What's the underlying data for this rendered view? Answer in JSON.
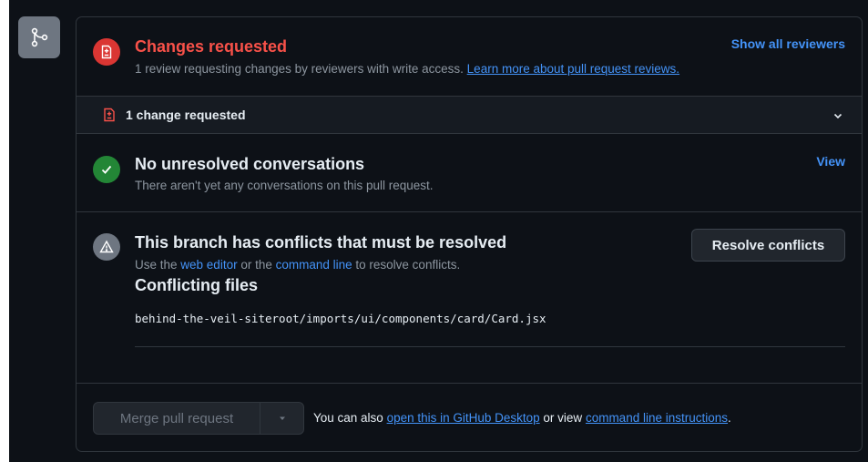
{
  "reviews": {
    "title": "Changes requested",
    "desc_prefix": "1 review requesting changes by reviewers with write access. ",
    "desc_link": "Learn more about pull request reviews.",
    "show_all": "Show all reviewers",
    "change_count": "1 change requested"
  },
  "conversations": {
    "title": "No unresolved conversations",
    "desc": "There aren't yet any conversations on this pull request.",
    "view": "View"
  },
  "conflicts": {
    "title": "This branch has conflicts that must be resolved",
    "desc_prefix": "Use the ",
    "web_editor": "web editor",
    "desc_mid": " or the ",
    "command_line": "command line",
    "desc_suffix": " to resolve conflicts.",
    "resolve_button": "Resolve conflicts",
    "files_heading": "Conflicting files",
    "files": [
      "behind-the-veil-siteroot/imports/ui/components/card/Card.jsx"
    ]
  },
  "merge": {
    "button": "Merge pull request",
    "text_prefix": "You can also ",
    "desktop_link": "open this in GitHub Desktop",
    "text_mid": " or view ",
    "cli_link": "command line instructions",
    "text_suffix": "."
  },
  "colors": {
    "danger": "#f85149",
    "success": "#238636",
    "link": "#4493f8",
    "muted": "#8d96a0"
  },
  "icons": {
    "merge": "git-merge-icon",
    "review": "file-diff-icon",
    "check": "check-icon",
    "alert": "alert-icon",
    "chevron": "chevron-down-icon",
    "caret": "triangle-down-icon"
  }
}
